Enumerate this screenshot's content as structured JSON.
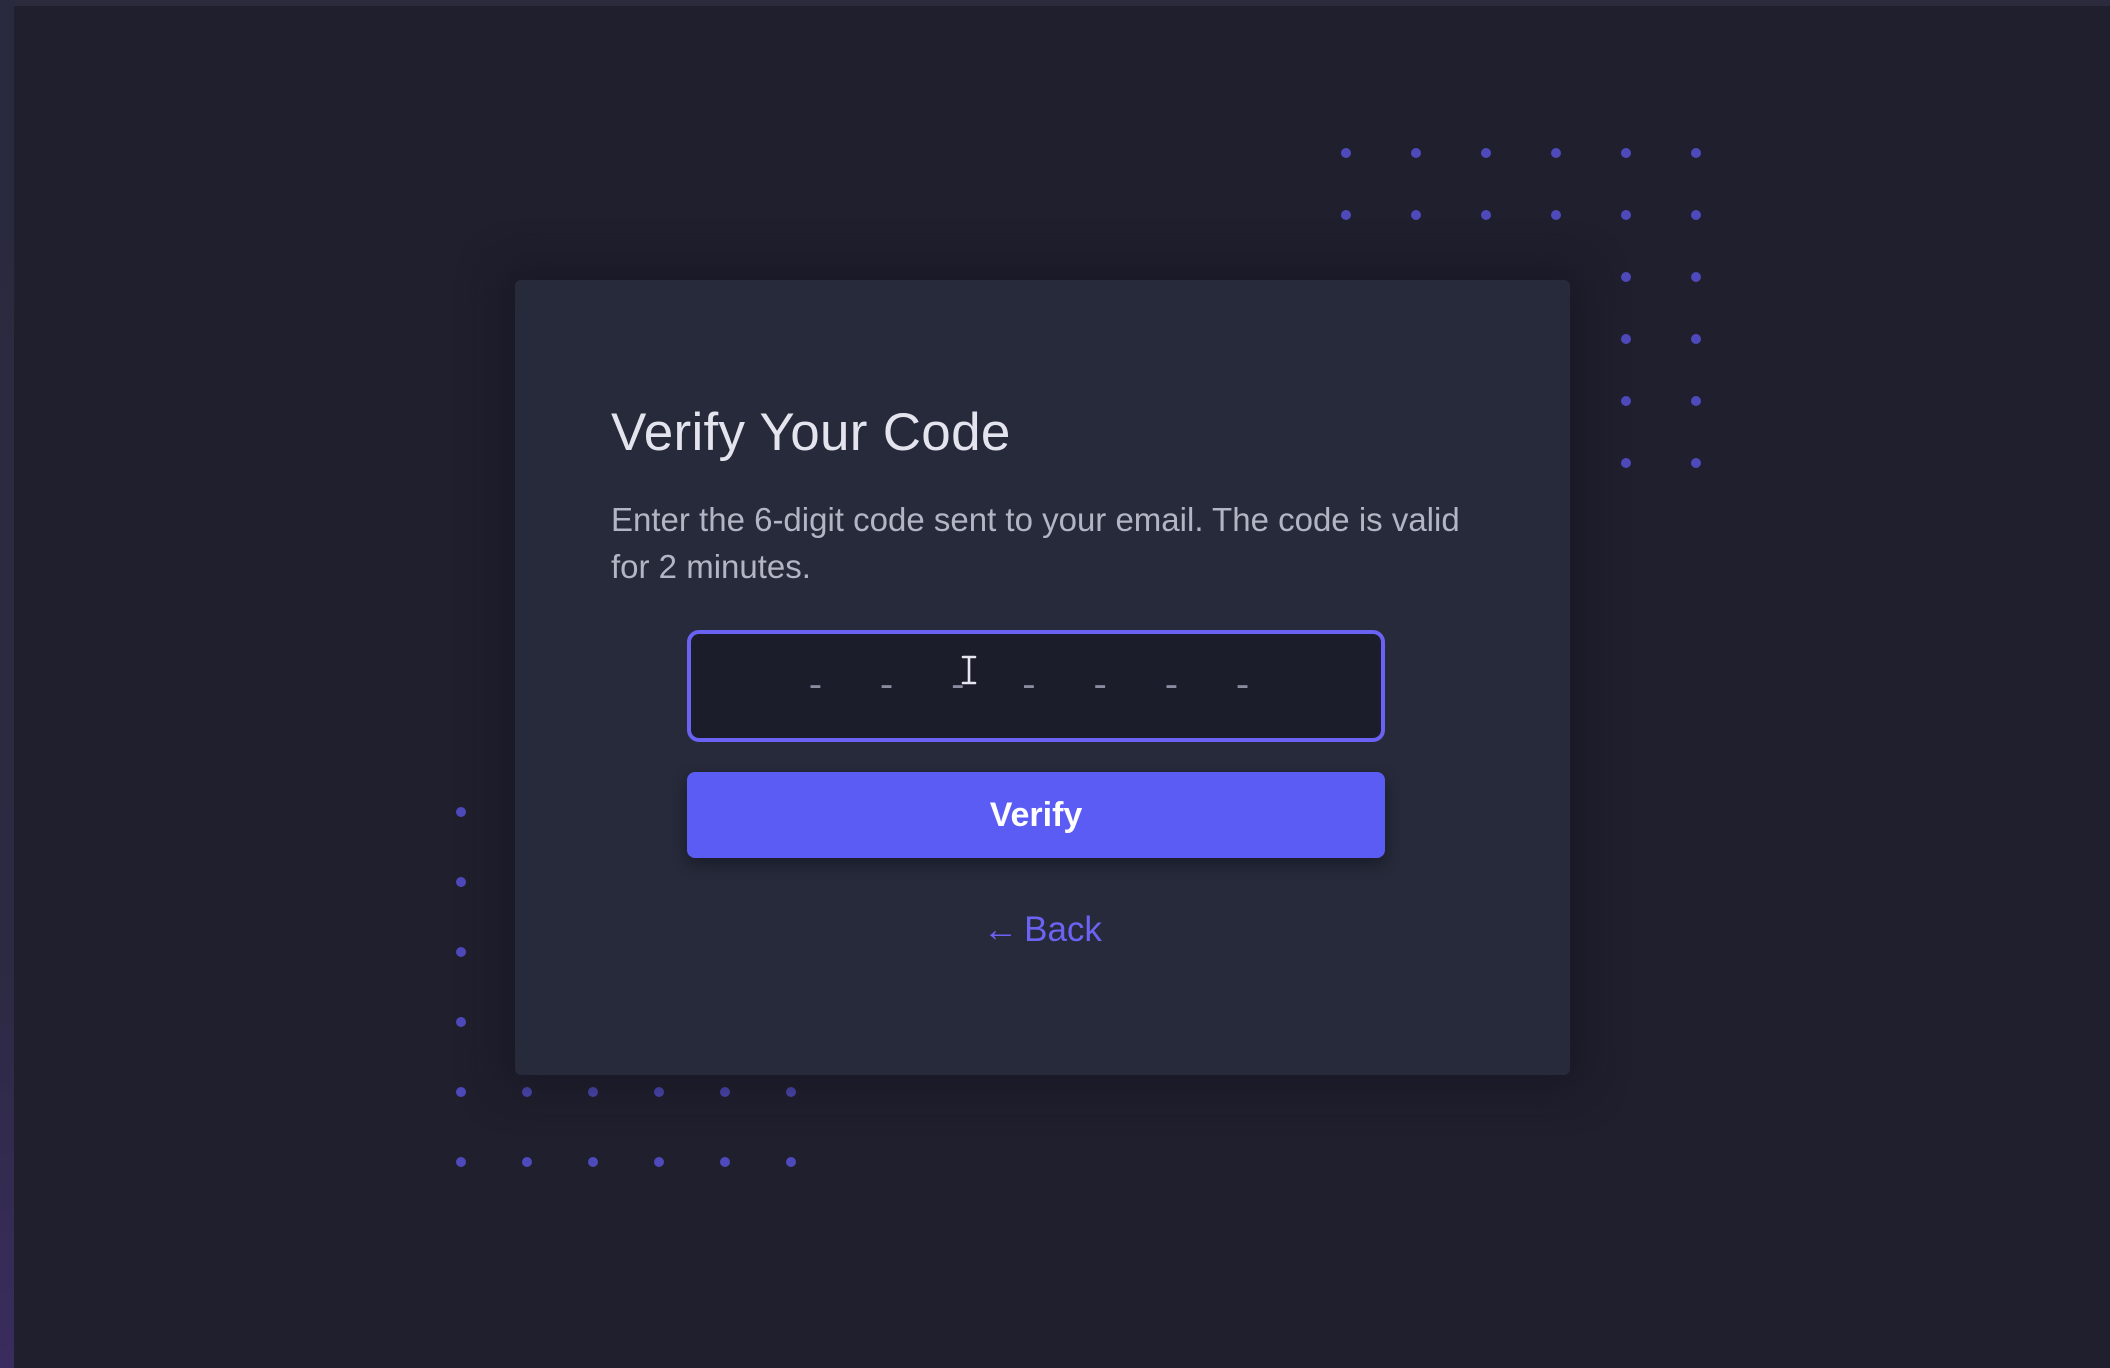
{
  "colors": {
    "background": "#1f1f2d",
    "card": "#262a3a",
    "accent": "#5b5cf4",
    "dot": "#5b55e0",
    "title_text": "#e4e4ee",
    "body_text": "#b3b5c4"
  },
  "verify_card": {
    "title": "Verify Your Code",
    "description": "Enter the 6-digit code sent to your email. The code is valid for 2 minutes.",
    "code_input": {
      "value": "",
      "placeholder": "- - - - - - -"
    },
    "verify_button_label": "Verify",
    "back_link": {
      "arrow": "←",
      "label": "Back"
    }
  },
  "icons": {
    "text_cursor": "text-cursor-icon",
    "back_arrow": "left-arrow-icon",
    "decor_dots": "dot-grid-icon"
  }
}
